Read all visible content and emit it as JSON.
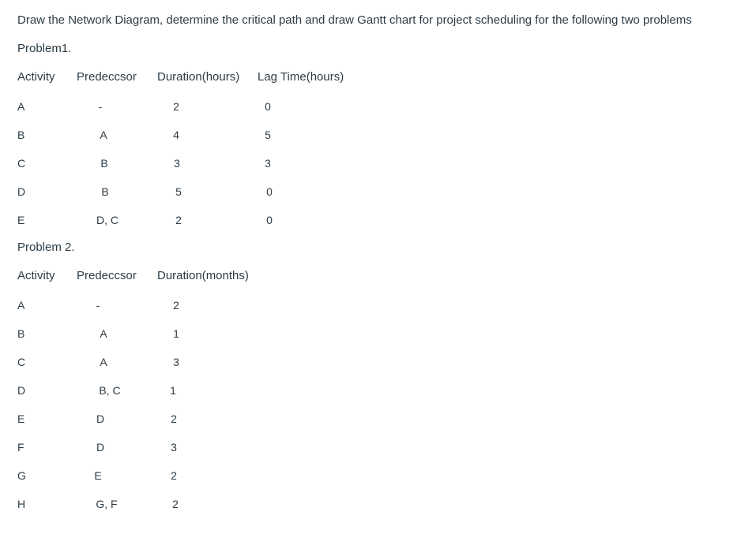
{
  "instruction": "Draw the Network Diagram, determine the critical path and draw Gantt chart for project scheduling  for the following two problems",
  "problem1": {
    "title": "Problem1.",
    "headers": [
      "Activity",
      "Predeccsor",
      "Duration(hours)",
      "Lag Time(hours)"
    ],
    "rows": [
      {
        "activity": "A",
        "predecessor": "-",
        "duration": "2",
        "lag": "0"
      },
      {
        "activity": "B",
        "predecessor": "A",
        "duration": "4",
        "lag": "5"
      },
      {
        "activity": "C",
        "predecessor": "B",
        "duration": "3",
        "lag": "3"
      },
      {
        "activity": "D",
        "predecessor": "B",
        "duration": "5",
        "lag": "0"
      },
      {
        "activity": "E",
        "predecessor": "D, C",
        "duration": "2",
        "lag": "0"
      }
    ]
  },
  "problem2": {
    "title": "Problem 2.",
    "headers": [
      "Activity",
      "Predeccsor",
      "Duration(months)"
    ],
    "rows": [
      {
        "activity": "A",
        "predecessor": "-",
        "duration": "2"
      },
      {
        "activity": "B",
        "predecessor": "A",
        "duration": "1"
      },
      {
        "activity": "C",
        "predecessor": "A",
        "duration": "3"
      },
      {
        "activity": "D",
        "predecessor": "B, C",
        "duration": "1"
      },
      {
        "activity": "E",
        "predecessor": "D",
        "duration": "2"
      },
      {
        "activity": "F",
        "predecessor": "D",
        "duration": "3"
      },
      {
        "activity": "G",
        "predecessor": "E",
        "duration": "2"
      },
      {
        "activity": "H",
        "predecessor": "G, F",
        "duration": "2"
      }
    ]
  }
}
